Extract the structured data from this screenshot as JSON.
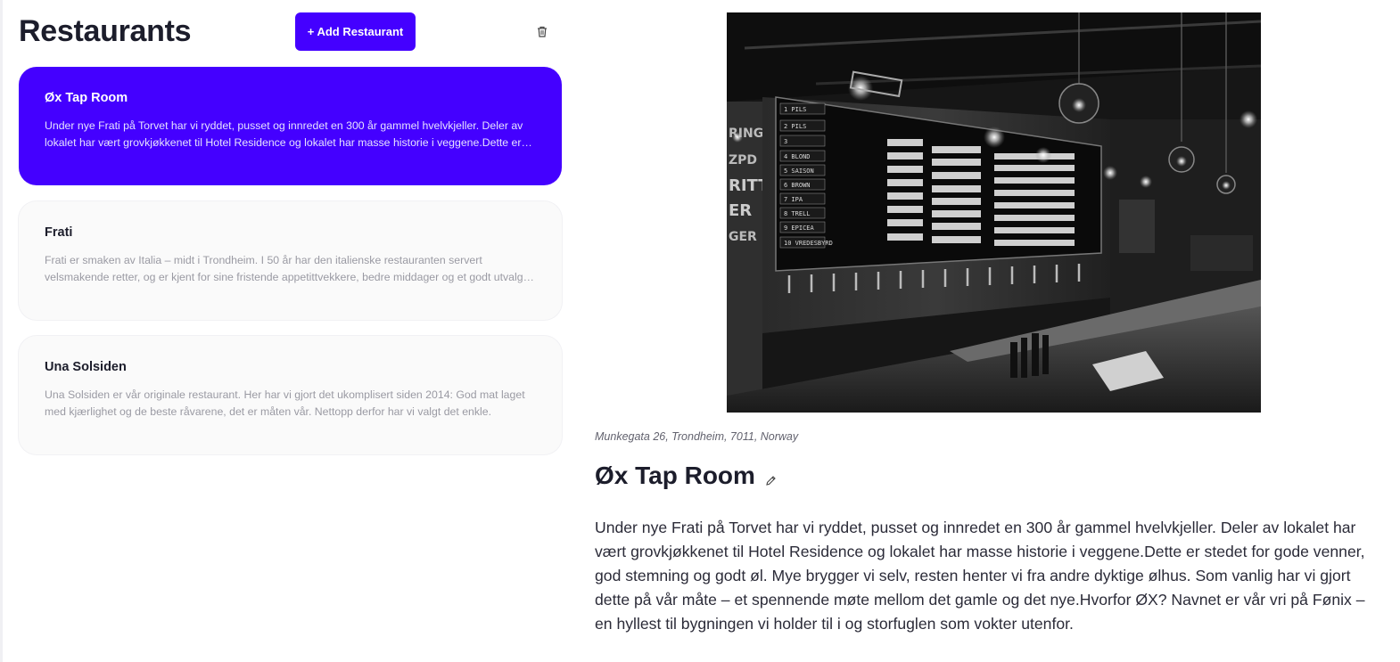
{
  "header": {
    "title": "Restaurants",
    "add_button_label": "+ Add Restaurant"
  },
  "restaurants": [
    {
      "name": "Øx Tap Room",
      "description": "Under nye Frati på Torvet har vi ryddet, pusset og innredet en 300 år gammel hvelvkjeller. Deler av lokalet har vært grovkjøkkenet til Hotel Residence og lokalet har masse historie i veggene.Dette er stedet for gode venner, god stemning og godt øl.",
      "selected": true
    },
    {
      "name": "Frati",
      "description": "Frati er smaken av Italia – midt i Trondheim. I 50 år har den italienske restauranten servert velsmakende retter, og er kjent for sine fristende appetittvekkere, bedre middager og et godt utvalg av viner.",
      "selected": false
    },
    {
      "name": "Una Solsiden",
      "description": "Una Solsiden er vår originale restaurant. Her har vi gjort det ukomplisert siden 2014: God mat laget med kjærlighet og de beste råvarene, det er måten vår. Nettopp derfor har vi valgt det enkle.",
      "selected": false
    }
  ],
  "detail": {
    "address": "Munkegata 26, Trondheim, 7011, Norway",
    "name": "Øx Tap Room",
    "description": "Under nye Frati på Torvet har vi ryddet, pusset og innredet en 300 år gammel hvelvkjeller. Deler av lokalet har vært grovkjøkkenet til Hotel Residence og lokalet har masse historie i veggene.Dette er stedet for gode venner, god stemning og godt øl. Mye brygger vi selv, resten henter vi fra andre dyktige ølhus. Som vanlig har vi gjort dette på vår måte – et spennende møte mellom det gamle og det nye.Hvorfor ØX? Navnet er vår vri på Fønix – en hyllest til bygningen vi holder til i og storfuglen som vokter utenfor."
  },
  "icons": {
    "delete": "trash-icon",
    "edit": "pencil-icon"
  },
  "colors": {
    "accent": "#4400ff",
    "card_bg": "#fafafa",
    "text_dark": "#1c1d2b",
    "text_muted": "#9a9aa3"
  }
}
